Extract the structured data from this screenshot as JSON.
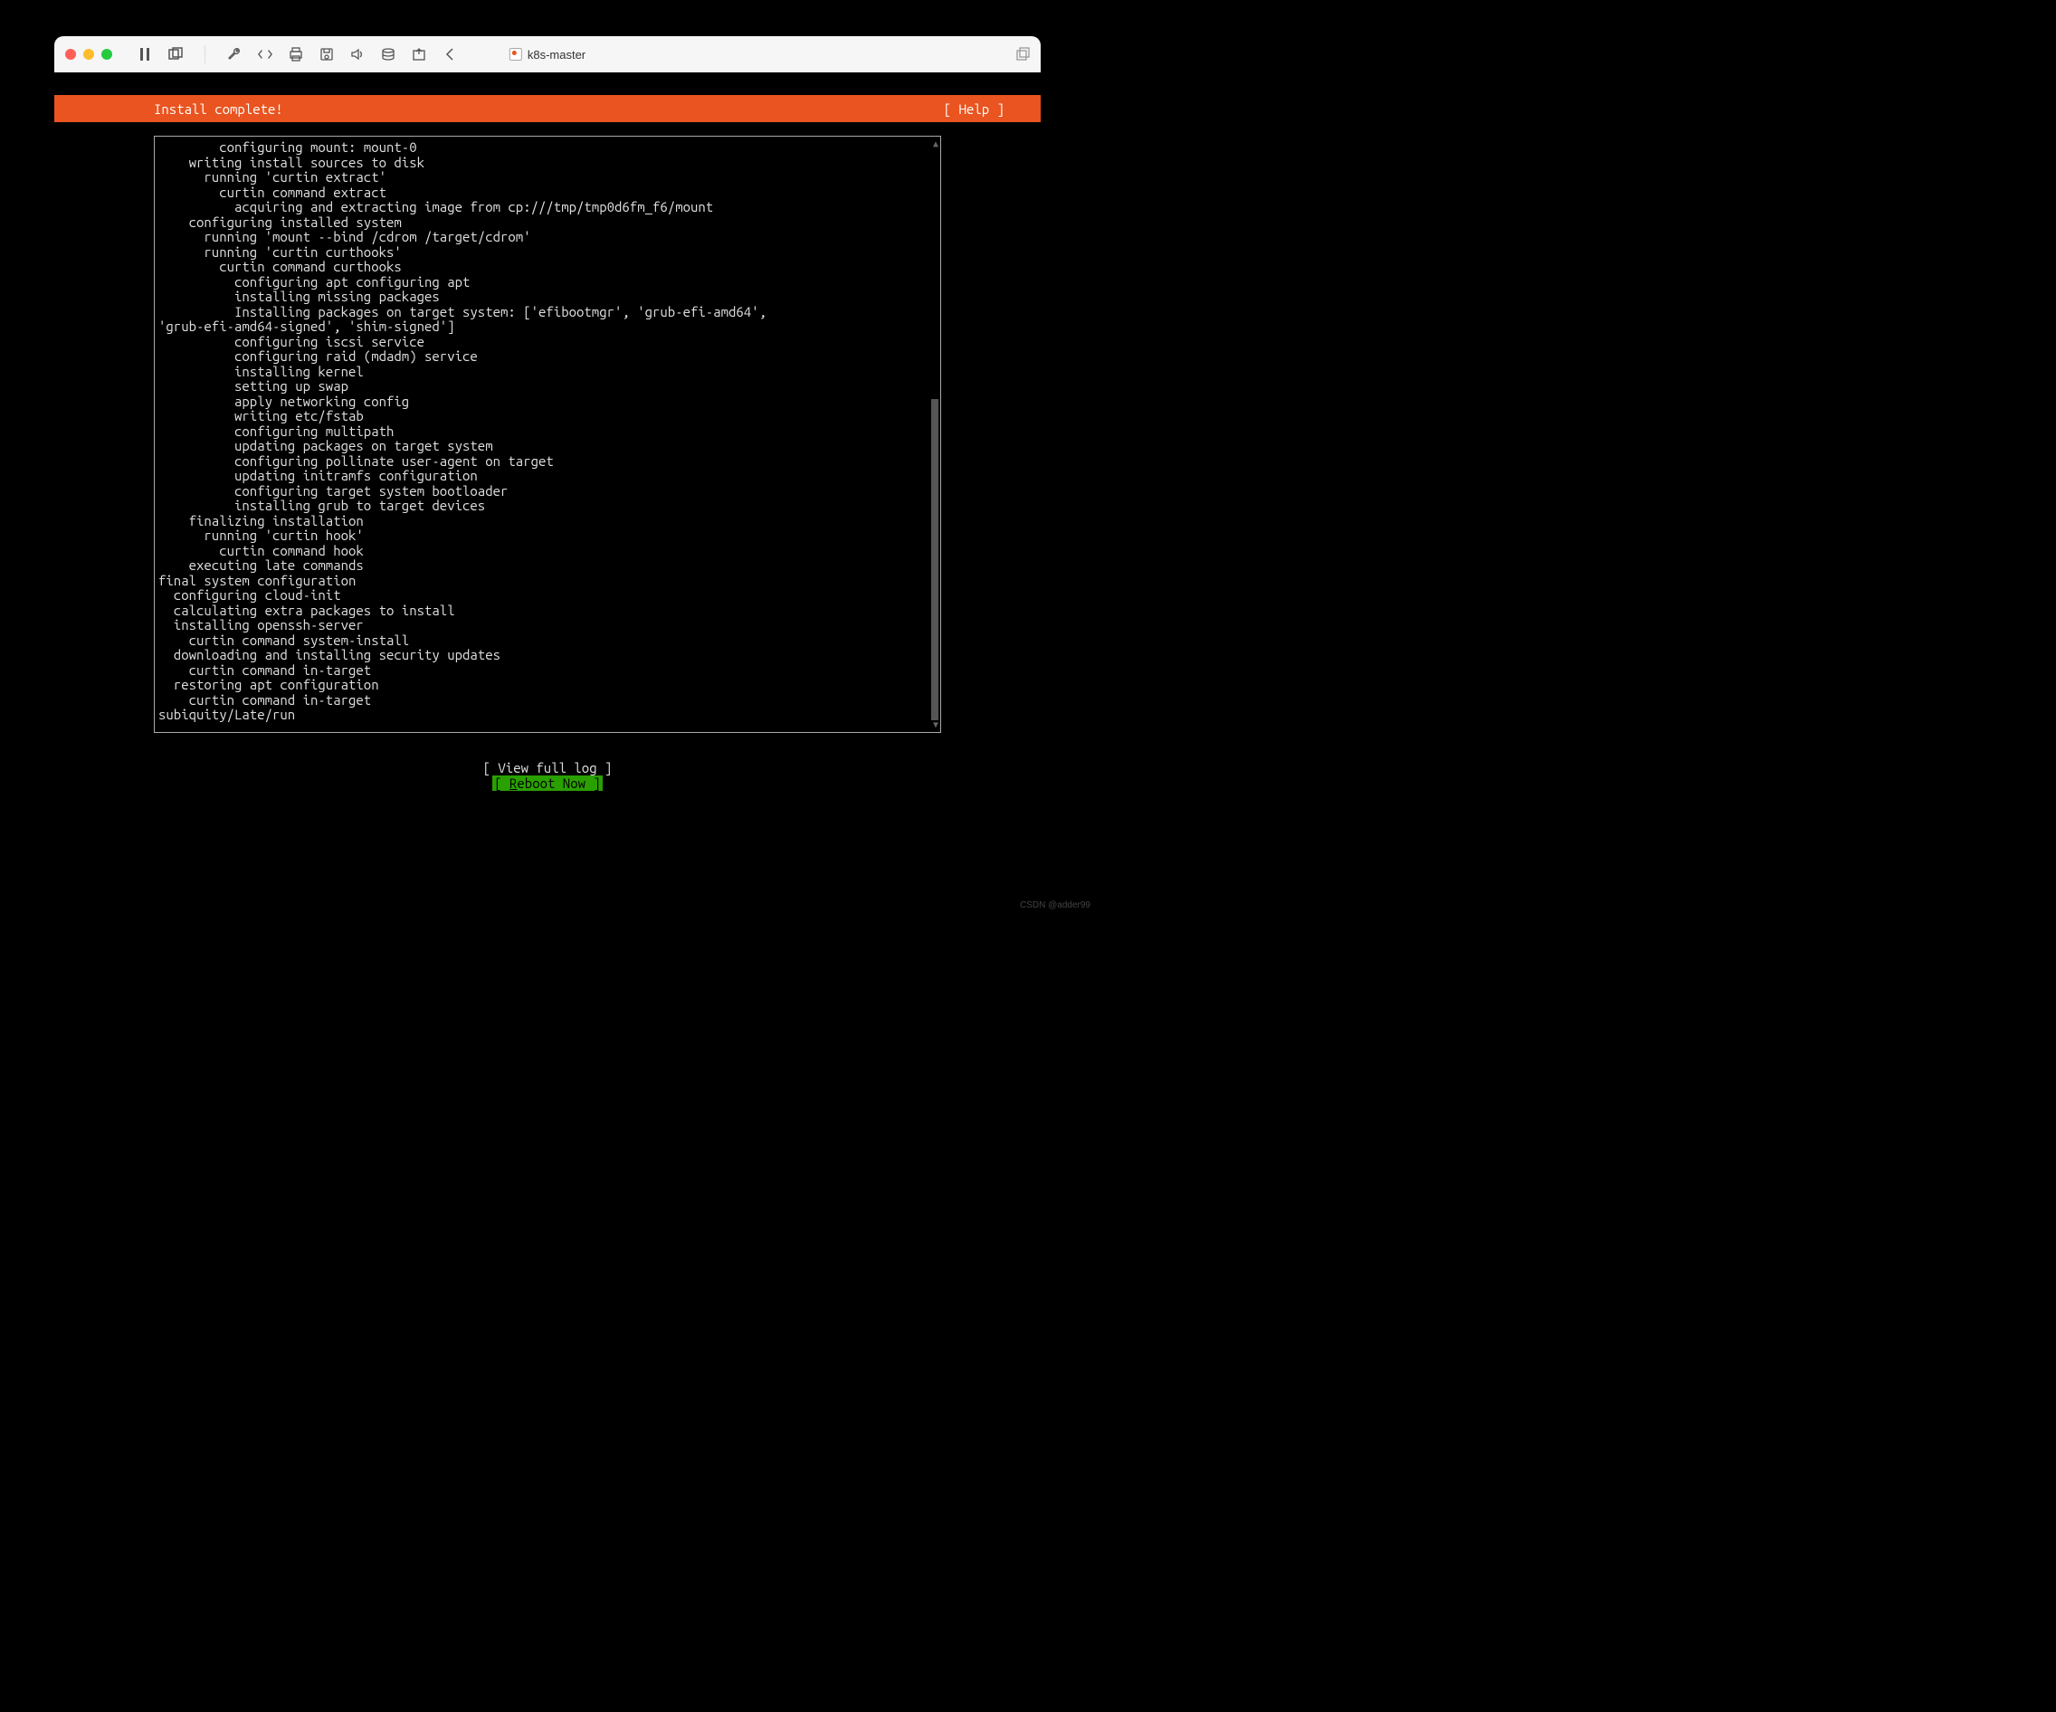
{
  "window": {
    "title": "k8s-master"
  },
  "statusbar": {
    "title": "Install complete!",
    "help": "[ Help ]"
  },
  "log": {
    "lines": "        configuring mount: mount-0\n    writing install sources to disk\n      running 'curtin extract'\n        curtin command extract\n          acquiring and extracting image from cp:///tmp/tmp0d6fm_f6/mount\n    configuring installed system\n      running 'mount --bind /cdrom /target/cdrom'\n      running 'curtin curthooks'\n        curtin command curthooks\n          configuring apt configuring apt\n          installing missing packages\n          Installing packages on target system: ['efibootmgr', 'grub-efi-amd64',\n'grub-efi-amd64-signed', 'shim-signed']\n          configuring iscsi service\n          configuring raid (mdadm) service\n          installing kernel\n          setting up swap\n          apply networking config\n          writing etc/fstab\n          configuring multipath\n          updating packages on target system\n          configuring pollinate user-agent on target\n          updating initramfs configuration\n          configuring target system bootloader\n          installing grub to target devices\n    finalizing installation\n      running 'curtin hook'\n        curtin command hook\n    executing late commands\nfinal system configuration\n  configuring cloud-init\n  calculating extra packages to install\n  installing openssh-server\n    curtin command system-install\n  downloading and installing security updates\n    curtin command in-target\n  restoring apt configuration\n    curtin command in-target\nsubiquity/Late/run"
  },
  "buttons": {
    "view_log": "[ View full log ]",
    "reboot_prefix": "[ ",
    "reboot_key": "R",
    "reboot_rest": "eboot Now    ]"
  },
  "watermark": "CSDN @adder99"
}
